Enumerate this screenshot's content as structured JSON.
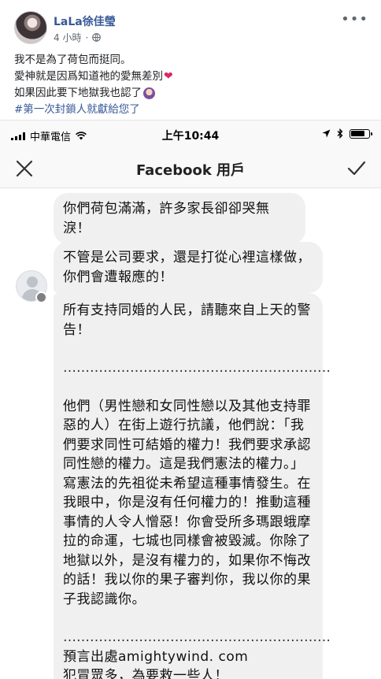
{
  "post": {
    "author": "LaLa徐佳瑩",
    "time": "4 小時",
    "more_icon": "more-icon",
    "lines": [
      "我不是為了荷包而挺同。",
      "愛神就是因爲知道祂的愛無差別",
      "如果因此要下地獄我也認了",
      "#第一次封鎖人就獻給您了"
    ]
  },
  "phone": {
    "carrier": "中華電信",
    "time": "上午10:44",
    "title": "Facebook 用戶"
  },
  "messages": [
    "你們荷包滿滿，許多家長卻卻哭無淚！",
    "不管是公司要求，還是打從心裡這樣做，你們會遭報應的！"
  ],
  "long_message": {
    "intro": "所有支持同婚的人民，請聽來自上天的警告！",
    "dots": "……………………………………………………",
    "body": "他們（男性戀和女同性戀以及其他支持罪惡的人）在街上遊行抗議，他們說：「我們要求同性可結婚的權力！我們要求承認同性戀的權力。這是我們憲法的權力。」寫憲法的先祖從未希望這種事情發生。在我眼中，你是沒有任何權力的！推動這種事情的人令人憎惡！你會受所多瑪跟蛾摩拉的命運，七城也同樣會被毀滅。你除了地獄以外，是沒有權力的，如果你不悔改的話！我以你的果子審判你，我以你的果子我認識你。",
    "dots2": "……………………………………………………",
    "source": "預言出處amightywind. com",
    "closing": "犯冒眾多，為要救一些人！"
  }
}
